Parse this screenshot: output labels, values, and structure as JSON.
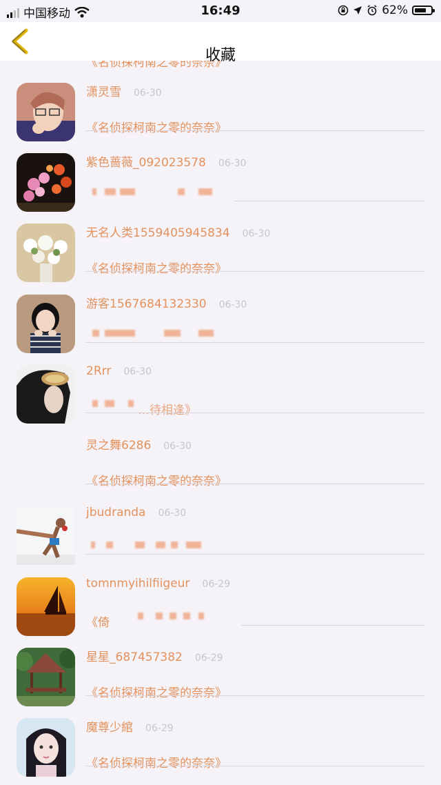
{
  "status_bar": {
    "carrier": "中国移动",
    "time": "16:49",
    "battery": "62%",
    "battery_level": 0.62
  },
  "nav": {
    "title": "收藏",
    "back_icon": "chevron-left-icon"
  },
  "colors": {
    "accent": "#e3915d",
    "date": "#c8c3cc",
    "divider": "#d8d3dc",
    "background": "#f5f3f8"
  },
  "top_partial_title": "《名侦探柯南之零的奈奈》",
  "items": [
    {
      "name": "潇灵雪",
      "date": "06-30",
      "title": "《名侦探柯南之零的奈奈》",
      "avatar": "anime-man-glasses"
    },
    {
      "name": "紫色蔷薇_092023578",
      "date": "06-30",
      "title": "",
      "avatar": "pink-orchid-flowers"
    },
    {
      "name": "无名人类1559405945834",
      "date": "06-30",
      "title": "《名侦探柯南之零的奈奈》",
      "avatar": "white-flower-bouquet"
    },
    {
      "name": "游客1567684132330",
      "date": "06-30",
      "title": "",
      "avatar": "girl-photo"
    },
    {
      "name": "2Rrr",
      "date": "06-30",
      "title": "…待相逢》",
      "avatar": "person-with-goggles"
    },
    {
      "name": "灵之舞6286",
      "date": "06-30",
      "title": "《名侦探柯南之零的奈奈》",
      "avatar": ""
    },
    {
      "name": "jbudranda",
      "date": "06-30",
      "title": "",
      "avatar": "kickboxer"
    },
    {
      "name": "tomnmyihilfiigeur",
      "date": "06-29",
      "title": "《倚",
      "avatar": "sailboat-sunset"
    },
    {
      "name": "星星_687457382",
      "date": "06-29",
      "title": "《名侦探柯南之零的奈奈》",
      "avatar": "garden-pavilion"
    },
    {
      "name": "魔尊少綰",
      "date": "06-29",
      "title": "《名侦探柯南之零的奈奈》",
      "avatar": "anime-girl-portrait"
    }
  ]
}
